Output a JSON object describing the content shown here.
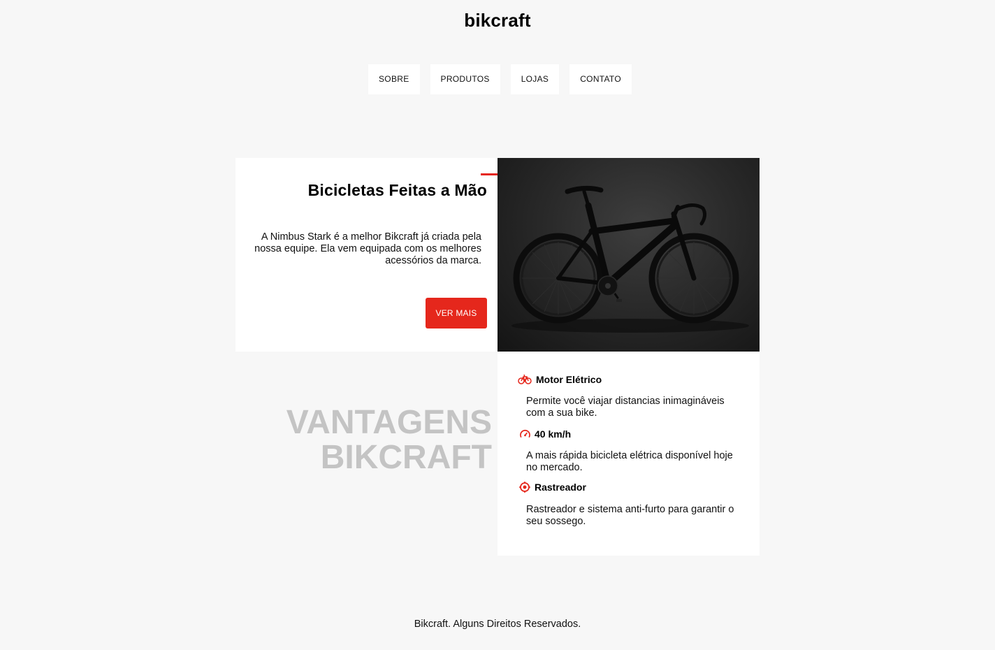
{
  "header": {
    "logo": "bikcraft",
    "nav": [
      {
        "label": "SOBRE"
      },
      {
        "label": "PRODUTOS"
      },
      {
        "label": "LOJAS"
      },
      {
        "label": "CONTATO"
      }
    ]
  },
  "intro": {
    "title": "Bicicletas Feitas a Mão",
    "text": "A Nimbus Stark é a melhor Bikcraft já criada pela nossa equipe. Ela vem equipada com os melhores acessórios da marca.",
    "button": "VER MAIS"
  },
  "advantages": {
    "title_line1": "VANTAGENS",
    "title_line2": "BIKCRAFT",
    "items": [
      {
        "icon": "bike-icon",
        "title": "Motor Elétrico",
        "text": "Permite você viajar distancias inimagináveis com a sua bike."
      },
      {
        "icon": "speedometer-icon",
        "title": "40 km/h",
        "text": "A mais rápida bicicleta elétrica disponível hoje no mercado."
      },
      {
        "icon": "tracker-icon",
        "title": "Rastreador",
        "text": "Rastreador e sistema anti-furto para garantir o seu sossego."
      }
    ]
  },
  "footer": {
    "text": "Bikcraft. Alguns Direitos Reservados."
  },
  "colors": {
    "accent": "#e5271c",
    "background": "#f7f7f7",
    "muted_heading": "#c4c4c4"
  }
}
